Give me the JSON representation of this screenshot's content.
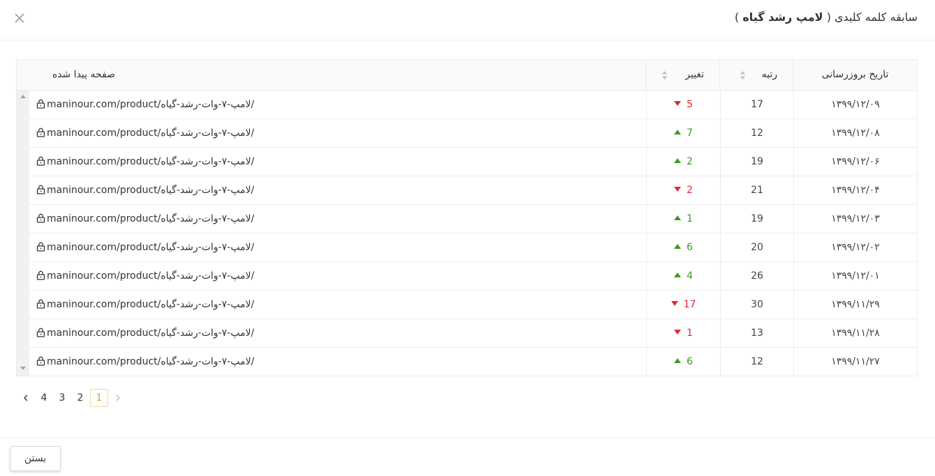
{
  "modal": {
    "title_prefix": "سابقه کلمه کلیدی (",
    "title_keyword": "لامپ رشد گیاه",
    "title_suffix": ")",
    "close_label": "بستن"
  },
  "table": {
    "columns": {
      "date": "تاریخ بروزرسانی",
      "rank": "رتبه",
      "change": "تغییر",
      "page": "صفحه پیدا شده"
    },
    "rows": [
      {
        "date": "۱۳۹۹/۱۲/۰۹",
        "rank": "17",
        "change": "5",
        "direction": "down",
        "page": "maninour.com/product/لامپ-۷-وات-رشد-گیاه/"
      },
      {
        "date": "۱۳۹۹/۱۲/۰۸",
        "rank": "12",
        "change": "7",
        "direction": "up",
        "page": "maninour.com/product/لامپ-۷-وات-رشد-گیاه/"
      },
      {
        "date": "۱۳۹۹/۱۲/۰۶",
        "rank": "19",
        "change": "2",
        "direction": "up",
        "page": "maninour.com/product/لامپ-۷-وات-رشد-گیاه/"
      },
      {
        "date": "۱۳۹۹/۱۲/۰۴",
        "rank": "21",
        "change": "2",
        "direction": "down",
        "page": "maninour.com/product/لامپ-۷-وات-رشد-گیاه/"
      },
      {
        "date": "۱۳۹۹/۱۲/۰۳",
        "rank": "19",
        "change": "1",
        "direction": "up",
        "page": "maninour.com/product/لامپ-۷-وات-رشد-گیاه/"
      },
      {
        "date": "۱۳۹۹/۱۲/۰۲",
        "rank": "20",
        "change": "6",
        "direction": "up",
        "page": "maninour.com/product/لامپ-۷-وات-رشد-گیاه/"
      },
      {
        "date": "۱۳۹۹/۱۲/۰۱",
        "rank": "26",
        "change": "4",
        "direction": "up",
        "page": "maninour.com/product/لامپ-۷-وات-رشد-گیاه/"
      },
      {
        "date": "۱۳۹۹/۱۱/۲۹",
        "rank": "30",
        "change": "17",
        "direction": "down",
        "page": "maninour.com/product/لامپ-۷-وات-رشد-گیاه/"
      },
      {
        "date": "۱۳۹۹/۱۱/۲۸",
        "rank": "13",
        "change": "1",
        "direction": "down",
        "page": "maninour.com/product/لامپ-۷-وات-رشد-گیاه/"
      },
      {
        "date": "۱۳۹۹/۱۱/۲۷",
        "rank": "12",
        "change": "6",
        "direction": "up",
        "page": "maninour.com/product/لامپ-۷-وات-رشد-گیاه/"
      }
    ]
  },
  "pagination": {
    "pages": [
      "1",
      "2",
      "3",
      "4"
    ],
    "current": "1"
  },
  "colors": {
    "up": "#3c9a1f",
    "down": "#e0282e",
    "active_page": "#c9a63b"
  }
}
